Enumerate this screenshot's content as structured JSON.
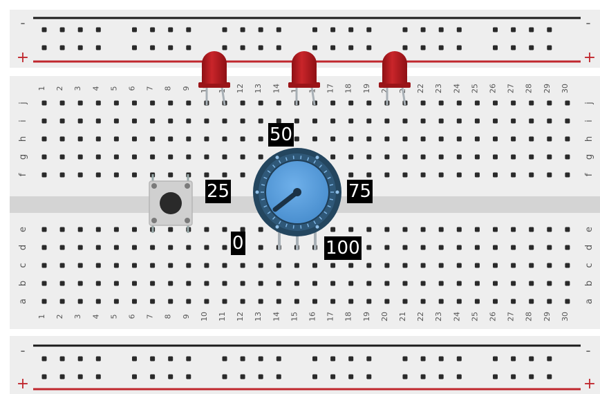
{
  "rails": {
    "minus": "-",
    "plus": "+"
  },
  "column_numbers": [
    "1",
    "2",
    "3",
    "4",
    "5",
    "6",
    "7",
    "8",
    "9",
    "10",
    "11",
    "12",
    "13",
    "14",
    "15",
    "16",
    "17",
    "18",
    "19",
    "20",
    "21",
    "22",
    "23",
    "24",
    "25",
    "26",
    "27",
    "28",
    "29",
    "30"
  ],
  "rows_top": [
    "j",
    "i",
    "h",
    "g",
    "f"
  ],
  "rows_bottom": [
    "e",
    "d",
    "c",
    "b",
    "a"
  ],
  "knob_labels": {
    "l0": "0",
    "l25": "25",
    "l50": "50",
    "l75": "75",
    "l100": "100"
  },
  "components": {
    "leds": [
      {
        "name": "led-1"
      },
      {
        "name": "led-2"
      },
      {
        "name": "led-3"
      }
    ],
    "push_button": "push-button",
    "potentiometer": "potentiometer-knob"
  },
  "colors": {
    "board": "#eeeeee",
    "rail_red": "#c0272d",
    "rail_black": "#1c1c1c",
    "led": "#b3191d",
    "knob_body": "#24465f",
    "knob_face": "#5b9fdc",
    "label_bg": "#000000",
    "label_text": "#ffffff"
  }
}
